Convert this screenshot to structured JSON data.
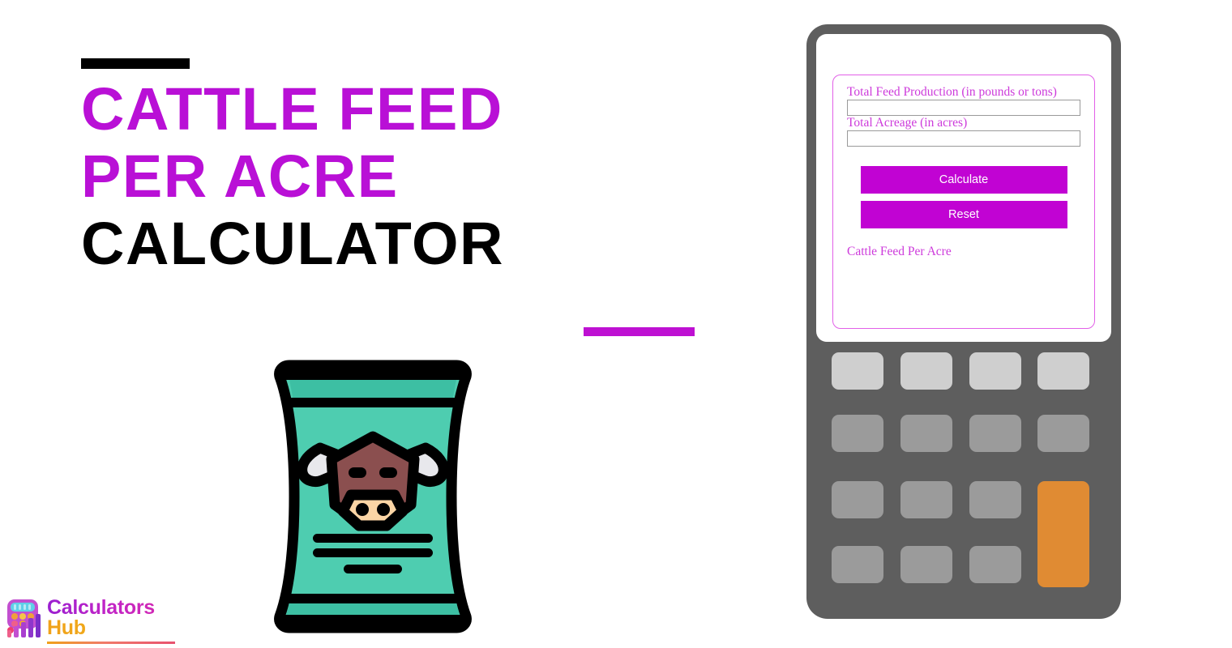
{
  "page": {
    "background_color": "#FFFFFF",
    "accent_color": "#B910D6",
    "title_accent_bar_color": "#000000",
    "bottom_accent_bar_color": "#BE10D2"
  },
  "title": {
    "line1": "Cattle Feed",
    "line2": "Per Acre",
    "line3": "Calculator"
  },
  "illustration": {
    "name": "cattle-feed-bag",
    "bag_color": "#4ECDB0",
    "bag_band_color": "#3DBFA3",
    "outline_color": "#000000",
    "cow_face_color": "#8B4F4F",
    "cow_muzzle_color": "#FBD5A5",
    "cow_horn_color": "#E8E8EC"
  },
  "logo": {
    "word1": "Calculators",
    "word2": "Hub",
    "word1_color": "#B320C8",
    "word2_color": "#F0A91A"
  },
  "calculator": {
    "device_color": "#5E5E5E",
    "screen_color": "#FFFFFF",
    "form_border_color": "#E260E8",
    "form": {
      "fields": [
        {
          "name": "total-feed-production",
          "label": "Total Feed Production (in pounds or tons)",
          "value": "",
          "placeholder": ""
        },
        {
          "name": "total-acreage",
          "label": "Total Acreage (in acres)",
          "value": "",
          "placeholder": ""
        }
      ],
      "calculate_label": "Calculate",
      "reset_label": "Reset",
      "result_label": "Cattle Feed Per Acre",
      "button_color": "#C103D3",
      "label_color": "#CD3ADB"
    },
    "keypad": {
      "rows": 4,
      "columns": 4,
      "top_row_color": "#CFCFCF",
      "key_color": "#9B9B9B",
      "accent_key_color": "#E08B33",
      "accent_key_name": "equals-key"
    }
  }
}
